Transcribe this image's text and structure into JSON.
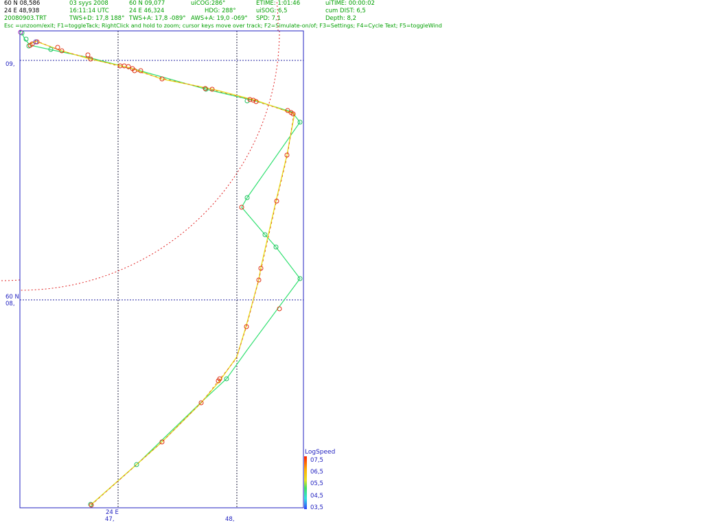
{
  "header": {
    "row1": [
      "60 N 08,586",
      "03 syys 2008",
      "60 N 09,077",
      "uiCOG:286°",
      "ETIME: 1:01:46",
      "uiTIME: 00:00:02"
    ],
    "row2": [
      "24 E 48,938",
      "16:11:14  UTC",
      "24 E 46,324",
      "HDG: 288°",
      "uiSOG: 6,5",
      "cum DIST: 6,5"
    ],
    "row3": [
      "20080903.TRT",
      "TWS+D: 17,8 188°",
      "TWS+A: 17,8 -089°",
      "AWS+A: 19,0 -069°",
      "SPD: 7,1",
      "Depth: 8,2"
    ],
    "hint": "Esc =unzoom/exit; F1=toggleTack; RightClick and hold to zoom; cursor keys move over track; F2=Simulate-on/of; F3=Settings; F4=Cycle Text; F5=toggleWind"
  },
  "axes": {
    "y_labels": [
      "09,",
      "60 N",
      "08,"
    ],
    "x_labels": [
      "24 E",
      "47,",
      "48,"
    ]
  },
  "legend": {
    "title": "LogSpeed",
    "ticks": [
      "07,5",
      "06,5",
      "05,5",
      "04,5",
      "03,5"
    ]
  },
  "colors": {
    "frame": "#2020c0",
    "grid": "#202080",
    "circle": "#e02020",
    "slow_track": "#30e070",
    "fast_track": "#e8e020",
    "marker": "#e03010"
  }
}
